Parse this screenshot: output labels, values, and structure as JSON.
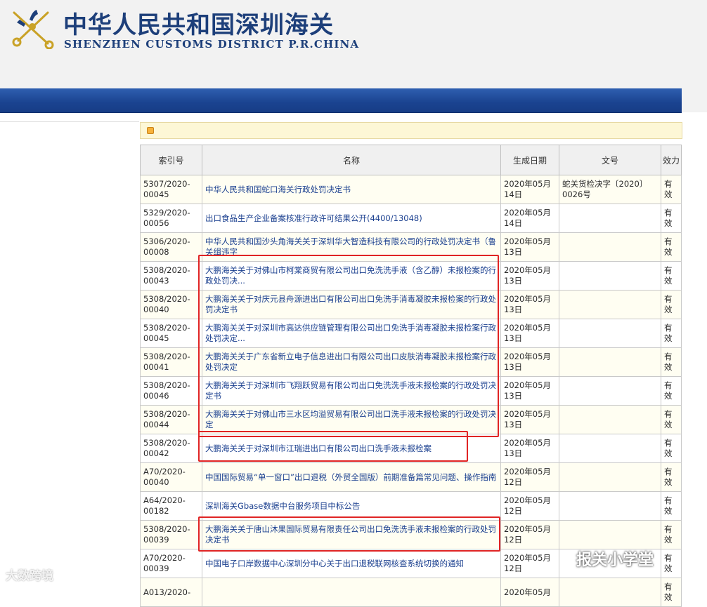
{
  "header": {
    "title_cn": "中华人民共和国深圳海关",
    "title_en": "SHENZHEN CUSTOMS DISTRICT P.R.CHINA"
  },
  "table": {
    "columns": [
      "索引号",
      "名称",
      "生成日期",
      "文号",
      "效力"
    ],
    "rows": [
      {
        "index": "5307/2020-00045",
        "name": "中华人民共和国蛇口海关行政处罚决定书",
        "date": "2020年05月14日",
        "doc_no": "蛇关货检决字〔2020〕0026号",
        "status": "有效"
      },
      {
        "index": "5329/2020-00056",
        "name": "出口食品生产企业备案核准行政许可结果公开(4400/13048)",
        "date": "2020年05月14日",
        "doc_no": "",
        "status": "有效"
      },
      {
        "index": "5306/2020-00008",
        "name": "中华人民共和国沙头角海关关于深圳华大智造科技有限公司的行政处罚决定书（鲁关缉违字",
        "date": "2020年05月13日",
        "doc_no": "",
        "status": "有效"
      },
      {
        "index": "5308/2020-00043",
        "name": "大鹏海关关于对佛山市柯棠商贸有限公司出口免洗洗手液（含乙醇）未报检案的行政处罚决...",
        "date": "2020年05月13日",
        "doc_no": "",
        "status": "有效"
      },
      {
        "index": "5308/2020-00040",
        "name": "大鹏海关关于对庆元县舟源进出口有限公司出口免洗手消毒凝胶未报检案的行政处罚决定书",
        "date": "2020年05月13日",
        "doc_no": "",
        "status": "有效"
      },
      {
        "index": "5308/2020-00045",
        "name": "大鹏海关关于对深圳市高达供应链管理有限公司出口免洗手消毒凝胶未报检案行政处罚决定...",
        "date": "2020年05月13日",
        "doc_no": "",
        "status": "有效"
      },
      {
        "index": "5308/2020-00041",
        "name": "大鹏海关关于广东省新立电子信息进出口有限公司出口皮肤消毒凝胶未报检案行政处罚决定",
        "date": "2020年05月13日",
        "doc_no": "",
        "status": "有效"
      },
      {
        "index": "5308/2020-00046",
        "name": "大鹏海关关于对深圳市飞翔跃贸易有限公司出口免洗洗手液未报检案的行政处罚决定书",
        "date": "2020年05月13日",
        "doc_no": "",
        "status": "有效"
      },
      {
        "index": "5308/2020-00044",
        "name": "大鹏海关关于对佛山市三水区均溢贸易有限公司出口洗手液未报检案的行政处罚决定",
        "date": "2020年05月13日",
        "doc_no": "",
        "status": "有效"
      },
      {
        "index": "5308/2020-00042",
        "name": "大鹏海关关于对深圳市江瑞进出口有限公司出口洗手液未报检案",
        "date": "2020年05月13日",
        "doc_no": "",
        "status": "有效"
      },
      {
        "index": "A70/2020-00040",
        "name": "中国国际贸易“单一窗口”出口退税（外贸全国版）前期准备篇常见问题、操作指南",
        "date": "2020年05月12日",
        "doc_no": "",
        "status": "有效"
      },
      {
        "index": "A64/2020-00182",
        "name": "深圳海关Gbase数据中台服务项目中标公告",
        "date": "2020年05月12日",
        "doc_no": "",
        "status": "有效"
      },
      {
        "index": "5308/2020-00039",
        "name": "大鹏海关关于唐山沐果国际贸易有限责任公司出口免洗洗手液未报检案的行政处罚决定书",
        "date": "2020年05月12日",
        "doc_no": "",
        "status": "有效"
      },
      {
        "index": "A70/2020-00039",
        "name": "中国电子口岸数据中心深圳分中心关于出口退税联网核查系统切换的通知",
        "date": "2020年05月12日",
        "doc_no": "",
        "status": "有效"
      },
      {
        "index": "A013/2020-",
        "name": "",
        "date": "2020年05月",
        "doc_no": "",
        "status": "有效"
      }
    ]
  },
  "watermarks": {
    "left": "大数跨境",
    "right": "报关小学堂"
  }
}
